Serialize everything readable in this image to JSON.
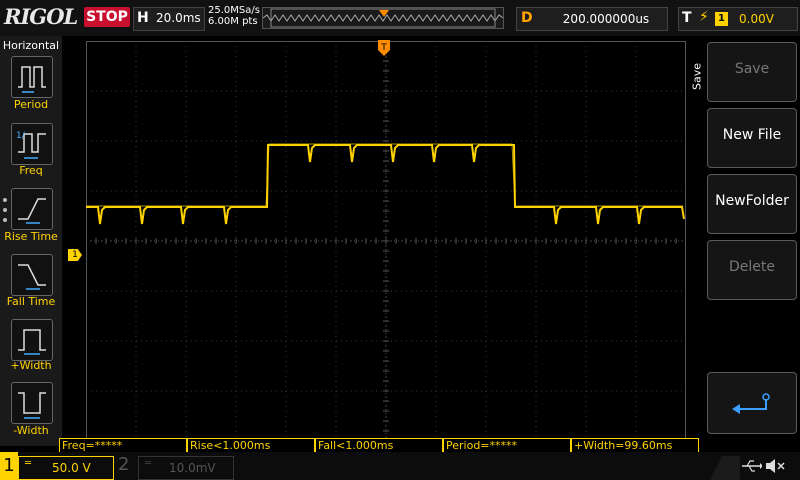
{
  "brand": "RIGOL",
  "run_state": "STOP",
  "horizontal": {
    "label": "H",
    "timebase": "20.0ms",
    "sample_rate": "25.0MSa/s",
    "memory_depth": "6.00M pts"
  },
  "delay": {
    "label": "D",
    "value": "200.000000us"
  },
  "trigger": {
    "label": "T",
    "edge_icon": "rising-edge-icon",
    "source": "1",
    "level": "0.00V"
  },
  "left_menu": {
    "title": "Horizontal",
    "items": [
      {
        "label": "Period",
        "icon": "period-icon"
      },
      {
        "label": "Freq",
        "icon": "freq-icon"
      },
      {
        "label": "Rise Time",
        "icon": "rise-time-icon"
      },
      {
        "label": "Fall Time",
        "icon": "fall-time-icon"
      },
      {
        "label": "+Width",
        "icon": "pos-width-icon"
      },
      {
        "label": "-Width",
        "icon": "neg-width-icon"
      }
    ]
  },
  "right_menu": {
    "title": "Save",
    "items": [
      {
        "label": "Save",
        "enabled": false
      },
      {
        "label": "New File",
        "enabled": true
      },
      {
        "label": "NewFolder",
        "enabled": true
      },
      {
        "label": "Delete",
        "enabled": false
      }
    ],
    "return_icon": "return-arrow-icon"
  },
  "channel1_marker": "1",
  "measurements": [
    "Freq=*****",
    "Rise<1.000ms",
    "Fall<1.000ms",
    "Period=*****",
    "+Width=99.60ms"
  ],
  "channels": [
    {
      "number": "1",
      "coupling": "DC",
      "scale": "50.0 V",
      "color": "#ffd300",
      "active": true
    },
    {
      "number": "2",
      "coupling": "DC",
      "scale": "10.0mV",
      "color": "#555555",
      "active": false
    }
  ],
  "status_icons": [
    "usb-icon",
    "speaker-muted-icon"
  ],
  "colors": {
    "trace": "#ffd300",
    "trigger": "#ff8c00",
    "stop": "#c8102e"
  }
}
